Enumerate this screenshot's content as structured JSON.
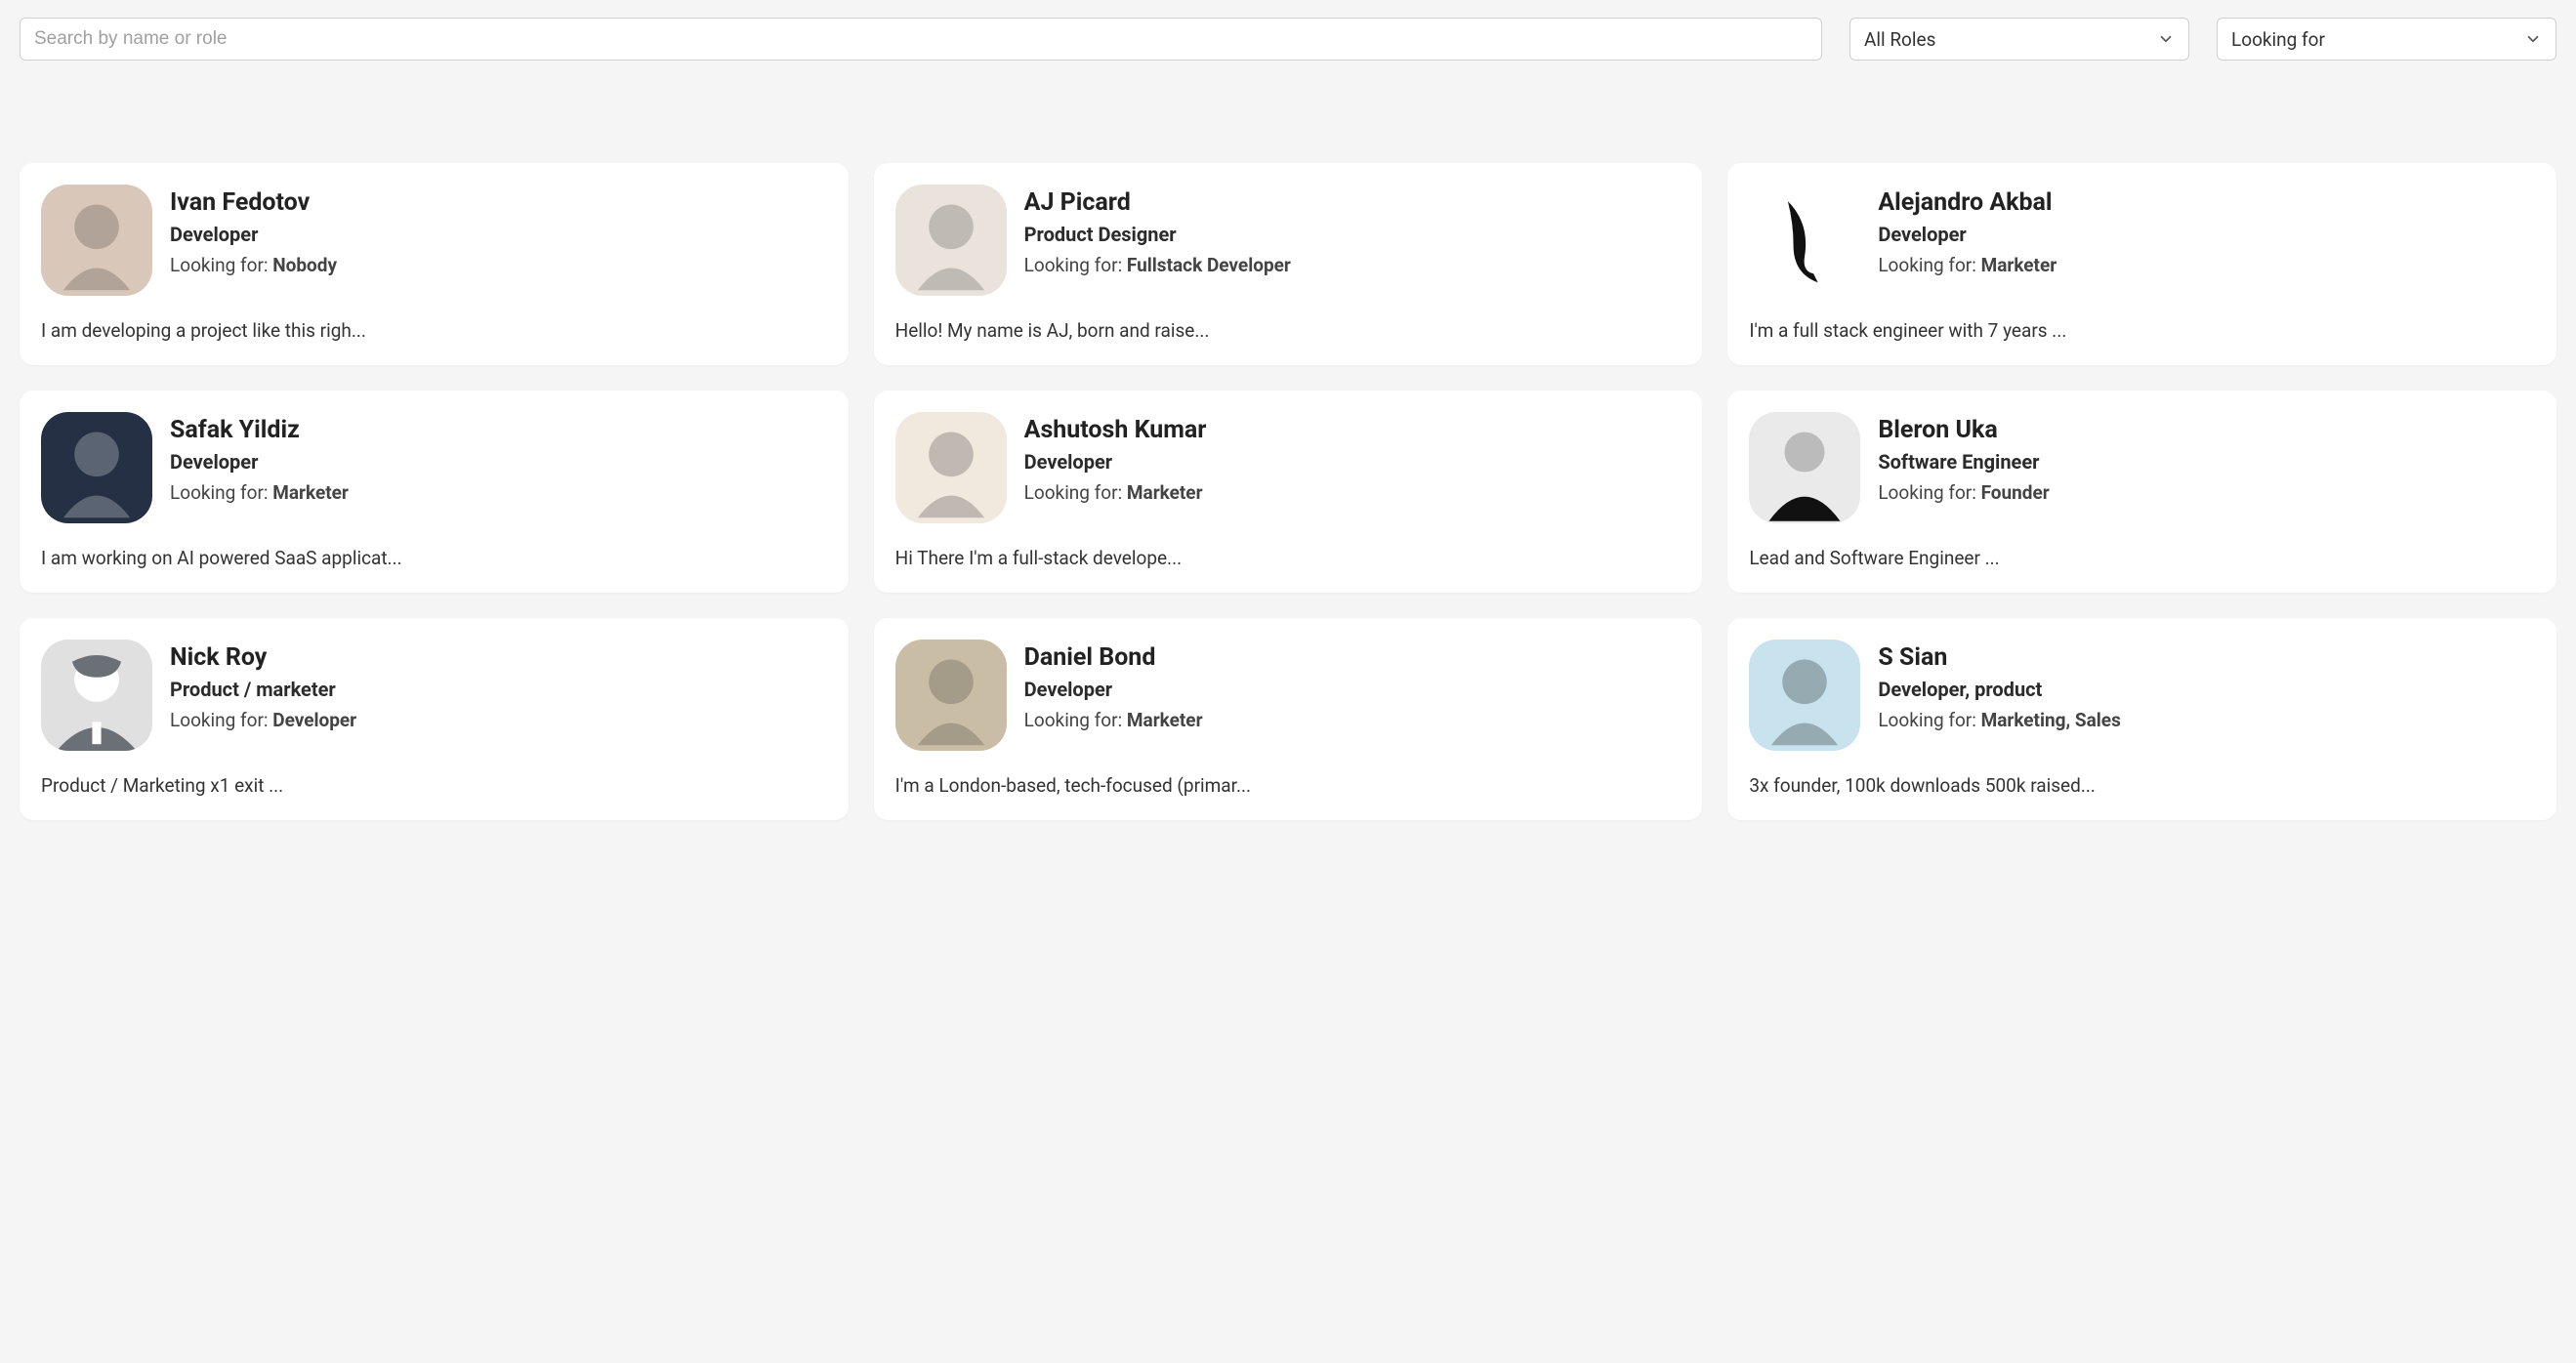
{
  "filters": {
    "search_placeholder": "Search by name or role",
    "role_dropdown": "All Roles",
    "looking_dropdown": "Looking for"
  },
  "looking_for_prefix": "Looking for: ",
  "profiles": [
    {
      "name": "Ivan Fedotov",
      "role": "Developer",
      "looking_for": "Nobody",
      "bio": "I am developing a project like this righ...",
      "avatar_bg": "#d9c7ba"
    },
    {
      "name": "AJ Picard",
      "role": "Product Designer",
      "looking_for": "Fullstack Developer",
      "bio": "Hello! My name is AJ, born and raise...",
      "avatar_bg": "#e9e3dc"
    },
    {
      "name": "Alejandro Akbal",
      "role": "Developer",
      "looking_for": "Marketer",
      "bio": "I'm a full stack engineer with 7 years ...",
      "avatar_bg": "#ffffff"
    },
    {
      "name": "Safak Yildiz",
      "role": "Developer",
      "looking_for": "Marketer",
      "bio": "I am working on AI powered SaaS applicat...",
      "avatar_bg": "#253044"
    },
    {
      "name": "Ashutosh Kumar",
      "role": "Developer",
      "looking_for": "Marketer",
      "bio": "Hi There I'm a full-stack develope...",
      "avatar_bg": "#f1e8de"
    },
    {
      "name": "Bleron Uka",
      "role": "Software Engineer",
      "looking_for": "Founder",
      "bio": "Lead and Software Engineer ...",
      "avatar_bg": "#eaeaea"
    },
    {
      "name": "Nick Roy",
      "role": "Product / marketer",
      "looking_for": "Developer",
      "bio": "Product / Marketing x1 exit ...",
      "avatar_bg": "#e0e0e0"
    },
    {
      "name": "Daniel Bond",
      "role": "Developer",
      "looking_for": "Marketer",
      "bio": "I'm a London-based, tech-focused (primar...",
      "avatar_bg": "#c9bda6"
    },
    {
      "name": "S Sian",
      "role": "Developer, product",
      "looking_for": "Marketing, Sales",
      "bio": "3x founder, 100k downloads 500k raised...",
      "avatar_bg": "#c9e3ee"
    }
  ]
}
